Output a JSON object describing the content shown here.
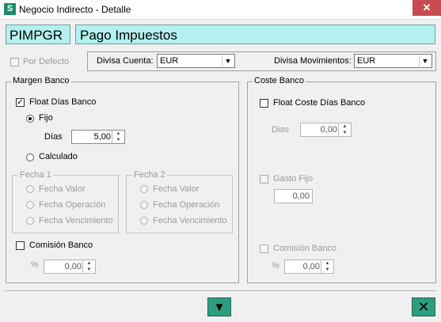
{
  "window": {
    "title": "Negocio Indirecto - Detalle",
    "close_glyph": "✕"
  },
  "header": {
    "code": "PIMPGR",
    "name": "Pago Impuestos"
  },
  "top": {
    "por_defecto_label": "Por Defecto",
    "divisa_cuenta_label": "Divisa Cuenta:",
    "divisa_cuenta_value": "EUR",
    "divisa_mov_label": "Divisa Movimientos:",
    "divisa_mov_value": "EUR"
  },
  "margen": {
    "legend": "Margen Banco",
    "float_label": "Float Días Banco",
    "fijo_label": "Fijo",
    "dias_label": "Días",
    "dias_value": "5,00",
    "calculado_label": "Calculado",
    "fecha1_legend": "Fecha 1",
    "fecha2_legend": "Fecha 2",
    "fecha_valor": "Fecha Valor",
    "fecha_operacion": "Fecha Operación",
    "fecha_vencimiento": "Fecha Vencimiento",
    "comision_label": "Comisión Banco",
    "pct_label": "%",
    "comision_value": "0,00"
  },
  "coste": {
    "legend": "Coste Banco",
    "float_label": "Float Coste Días Banco",
    "dias_label": "Dias",
    "dias_value": "0,00",
    "gasto_label": "Gasto Fijo",
    "gasto_value": "0,00",
    "comision_label": "Comisión Banco",
    "pct_label": "%",
    "comision_value": "0,00"
  },
  "footer": {
    "down_glyph": "▼",
    "close_glyph": "✕"
  },
  "colors": {
    "accent": "#2e9c7f",
    "header_fill": "#b3f0ef",
    "close_red": "#c74b50"
  }
}
